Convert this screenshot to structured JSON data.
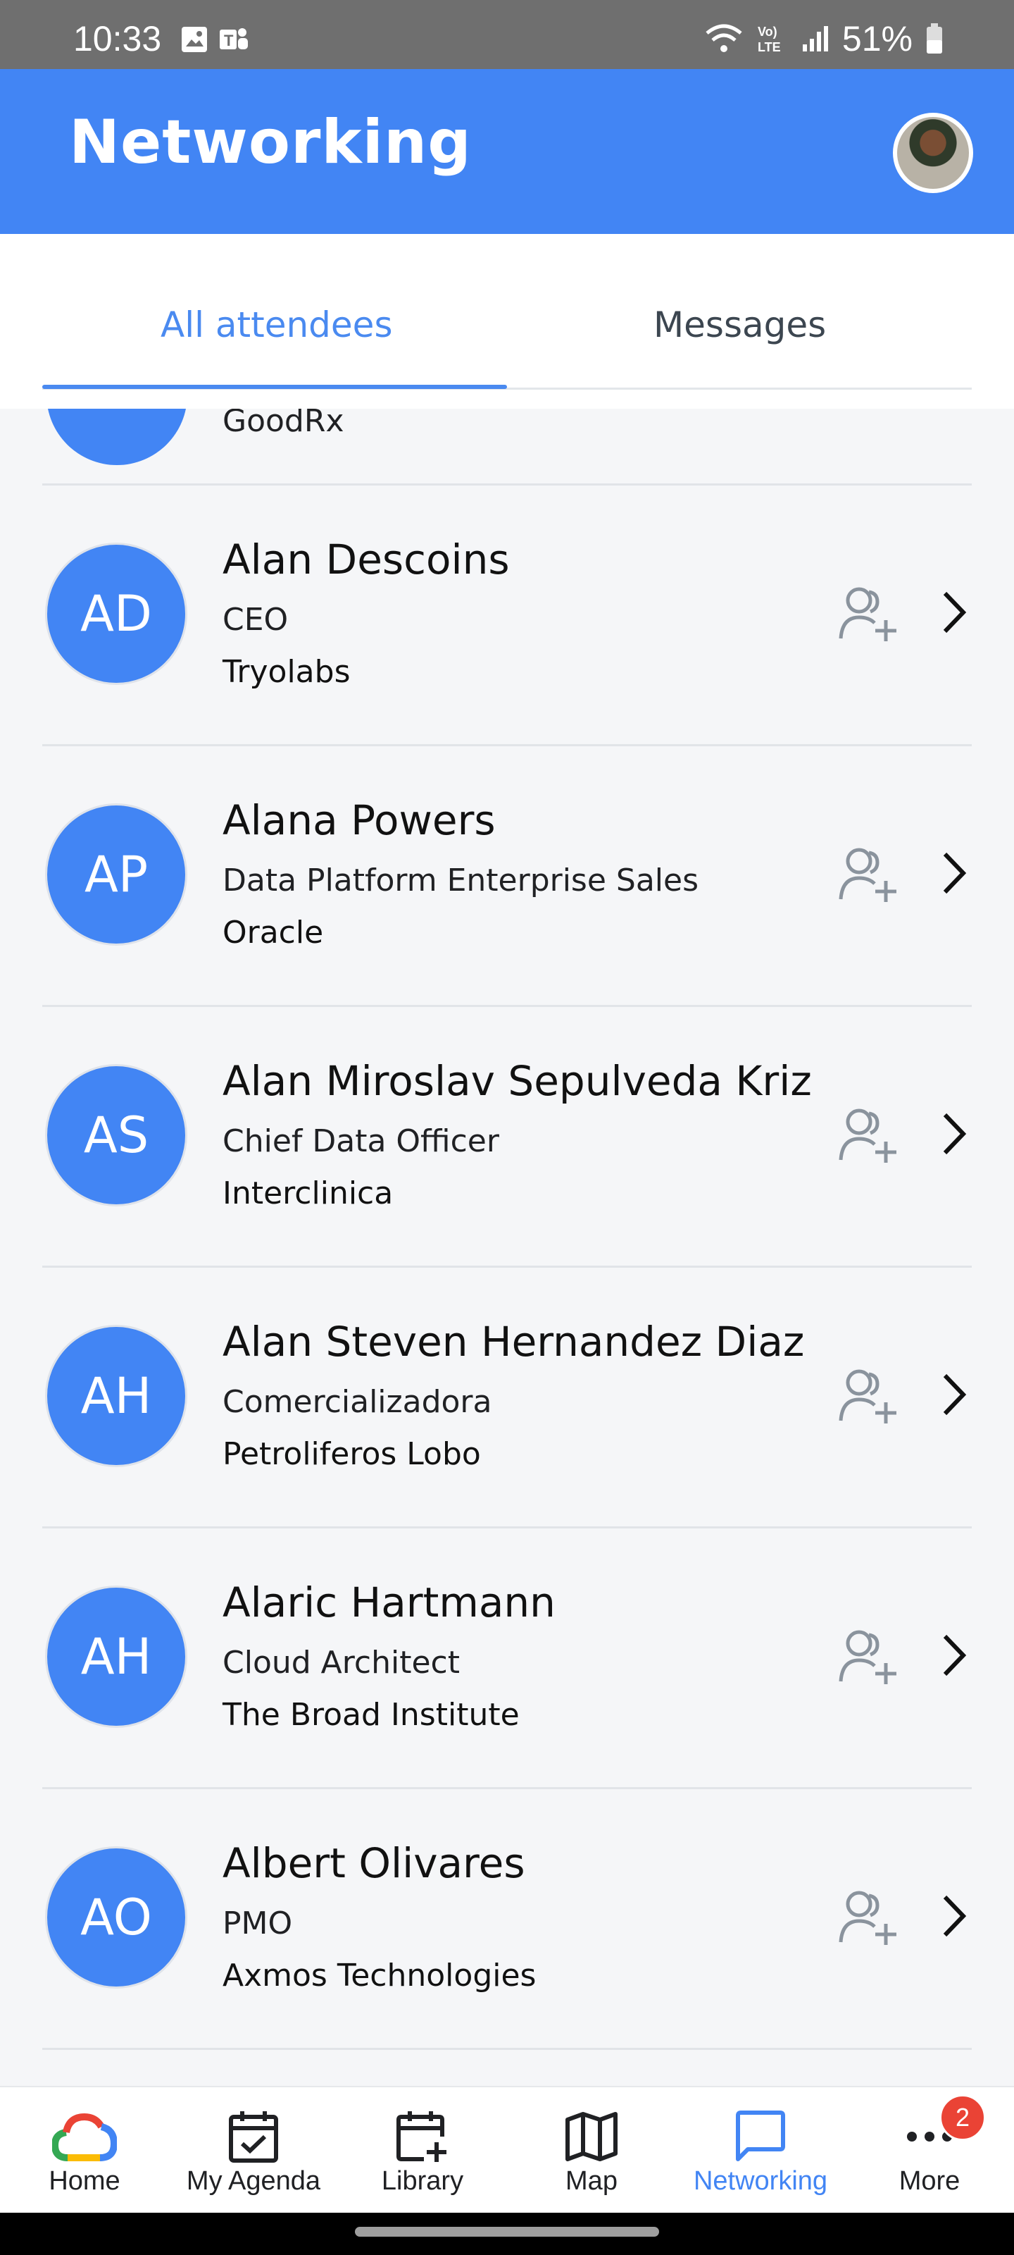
{
  "status_bar": {
    "time": "10:33",
    "battery": "51%"
  },
  "app_bar": {
    "title": "Networking"
  },
  "tabs": [
    {
      "label": "All attendees"
    },
    {
      "label": "Messages"
    }
  ],
  "partial_entry": {
    "company": "GoodRx"
  },
  "attendees": [
    {
      "initials": "AD",
      "name": "Alan Descoins",
      "role": "CEO",
      "company": "Tryolabs"
    },
    {
      "initials": "AP",
      "name": "Alana Powers",
      "role": "Data Platform Enterprise Sales",
      "company": "Oracle"
    },
    {
      "initials": "AS",
      "name": "Alan Miroslav Sepulveda Kriz",
      "role": "Chief Data Officer",
      "company": "Interclinica"
    },
    {
      "initials": "AH",
      "name": "Alan Steven Hernandez Diaz",
      "role": "Comercializadora",
      "company": "Petroliferos Lobo"
    },
    {
      "initials": "AH",
      "name": "Alaric Hartmann",
      "role": "Cloud Architect",
      "company": "The Broad Institute"
    },
    {
      "initials": "AO",
      "name": "Albert Olivares",
      "role": "PMO",
      "company": "Axmos Technologies"
    }
  ],
  "bottom_nav": [
    {
      "label": "Home",
      "icon": "google-cloud-icon"
    },
    {
      "label": "My Agenda",
      "icon": "calendar-check-icon"
    },
    {
      "label": "Library",
      "icon": "calendar-add-icon"
    },
    {
      "label": "Map",
      "icon": "map-icon"
    },
    {
      "label": "Networking",
      "icon": "chat-icon"
    },
    {
      "label": "More",
      "icon": "more-dots-icon",
      "badge": "2"
    }
  ],
  "colors": {
    "primary": "#4285f4",
    "badge": "#ea4335",
    "background": "#f5f6f8"
  }
}
